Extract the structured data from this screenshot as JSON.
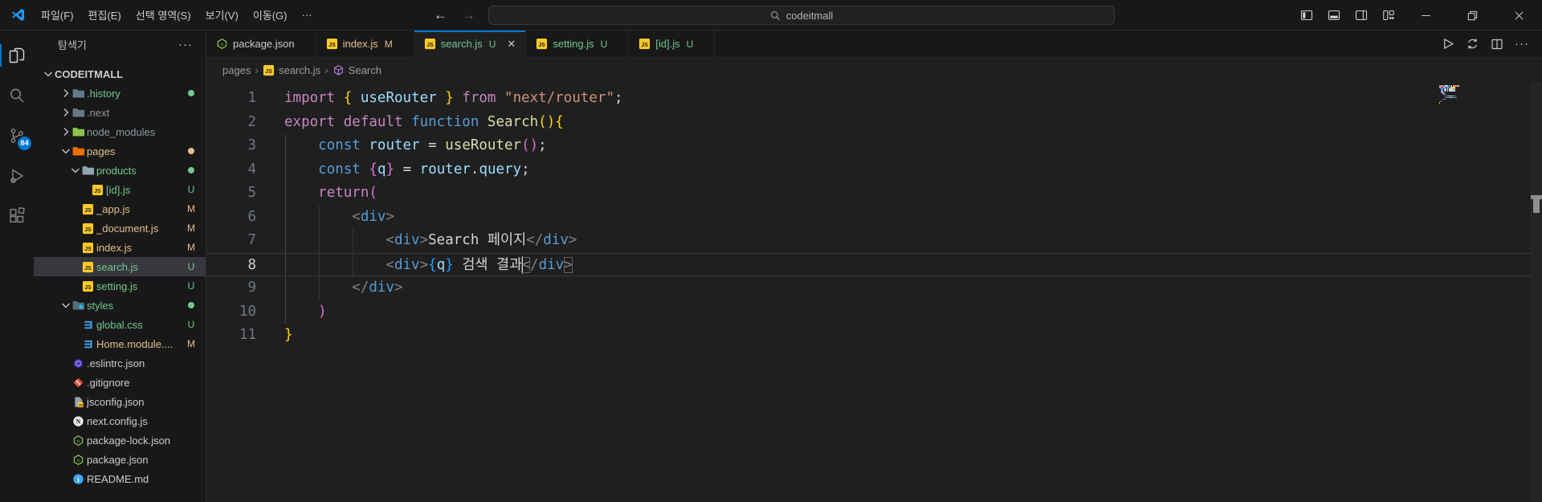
{
  "titlebar": {
    "menus": [
      "파일(F)",
      "편집(E)",
      "선택 영역(S)",
      "보기(V)",
      "이동(G)"
    ],
    "menu_more": "···",
    "search": "codeitmall",
    "window_controls": [
      "toggle-primary-sidebar",
      "toggle-panel",
      "toggle-secondary-sidebar",
      "customize-layout",
      "minimize",
      "restore",
      "close"
    ]
  },
  "activitybar": {
    "items": [
      {
        "name": "explorer",
        "active": true
      },
      {
        "name": "search",
        "active": false
      },
      {
        "name": "source-control",
        "active": false,
        "badge": "84"
      },
      {
        "name": "run-debug",
        "active": false
      },
      {
        "name": "extensions",
        "active": false
      }
    ]
  },
  "sidebar": {
    "title": "탐색기",
    "more": "···",
    "root": "CODEITMALL",
    "items": [
      {
        "label": ".history",
        "type": "folder",
        "level": 1,
        "expanded": false,
        "color": "green",
        "dot": "green",
        "icon": "folder-history"
      },
      {
        "label": ".next",
        "type": "folder",
        "level": 1,
        "expanded": false,
        "color": "gray",
        "dot": "",
        "icon": "folder-next"
      },
      {
        "label": "node_modules",
        "type": "folder",
        "level": 1,
        "expanded": false,
        "color": "gray",
        "dot": "",
        "icon": "folder-node"
      },
      {
        "label": "pages",
        "type": "folder",
        "level": 1,
        "expanded": true,
        "color": "tan",
        "dot": "tan",
        "icon": "folder-pages"
      },
      {
        "label": "products",
        "type": "folder",
        "level": 2,
        "expanded": true,
        "color": "green",
        "dot": "green",
        "icon": "folder-products"
      },
      {
        "label": "[id].js",
        "type": "file",
        "level": 3,
        "color": "green",
        "badge": "U",
        "icon": "js"
      },
      {
        "label": "_app.js",
        "type": "file",
        "level": 2,
        "color": "tan",
        "badge": "M",
        "icon": "js"
      },
      {
        "label": "_document.js",
        "type": "file",
        "level": 2,
        "color": "tan",
        "badge": "M",
        "icon": "js"
      },
      {
        "label": "index.js",
        "type": "file",
        "level": 2,
        "color": "tan",
        "badge": "M",
        "icon": "js"
      },
      {
        "label": "search.js",
        "type": "file",
        "level": 2,
        "color": "green",
        "badge": "U",
        "icon": "js",
        "selected": true
      },
      {
        "label": "setting.js",
        "type": "file",
        "level": 2,
        "color": "green",
        "badge": "U",
        "icon": "js"
      },
      {
        "label": "styles",
        "type": "folder",
        "level": 1,
        "expanded": true,
        "color": "green",
        "dot": "green",
        "icon": "folder-styles"
      },
      {
        "label": "global.css",
        "type": "file",
        "level": 2,
        "color": "green",
        "badge": "U",
        "icon": "css"
      },
      {
        "label": "Home.module....",
        "type": "file",
        "level": 2,
        "color": "tan",
        "badge": "M",
        "icon": "css"
      },
      {
        "label": ".eslintrc.json",
        "type": "file",
        "level": 1,
        "color": "default",
        "icon": "eslint"
      },
      {
        "label": ".gitignore",
        "type": "file",
        "level": 1,
        "color": "default",
        "icon": "git"
      },
      {
        "label": "jsconfig.json",
        "type": "file",
        "level": 1,
        "color": "default",
        "icon": "jsconfig"
      },
      {
        "label": "next.config.js",
        "type": "file",
        "level": 1,
        "color": "default",
        "icon": "next"
      },
      {
        "label": "package-lock.json",
        "type": "file",
        "level": 1,
        "color": "default",
        "icon": "npm"
      },
      {
        "label": "package.json",
        "type": "file",
        "level": 1,
        "color": "default",
        "icon": "npm"
      },
      {
        "label": "README.md",
        "type": "file",
        "level": 1,
        "color": "default",
        "icon": "readme"
      }
    ]
  },
  "tabs": [
    {
      "label": "package.json",
      "icon": "npm",
      "badge": "",
      "color": "default",
      "active": false
    },
    {
      "label": "index.js",
      "icon": "js",
      "badge": "M",
      "color": "tan",
      "active": false
    },
    {
      "label": "search.js",
      "icon": "js",
      "badge": "U",
      "color": "green",
      "active": true,
      "close": "✕"
    },
    {
      "label": "setting.js",
      "icon": "js",
      "badge": "U",
      "color": "green",
      "active": false
    },
    {
      "label": "[id].js",
      "icon": "js",
      "badge": "U",
      "color": "green",
      "active": false
    }
  ],
  "editor_actions": [
    "run",
    "compare-changes",
    "split-editor",
    "more-actions"
  ],
  "breadcrumb": [
    {
      "label": "pages",
      "icon": ""
    },
    {
      "label": "search.js",
      "icon": "js"
    },
    {
      "label": "Search",
      "icon": "symbol-method"
    }
  ],
  "code": {
    "active_line": 8,
    "lines": [
      {
        "num": "1",
        "tokens": [
          [
            "import ",
            "kw"
          ],
          [
            "{",
            "b1"
          ],
          [
            " ",
            "ws"
          ],
          [
            "useRouter",
            "var"
          ],
          [
            " ",
            "ws"
          ],
          [
            "}",
            "b1"
          ],
          [
            " ",
            "ws"
          ],
          [
            "from",
            "kw"
          ],
          [
            " ",
            "ws"
          ],
          [
            "\"next/router\"",
            "str"
          ],
          [
            ";",
            "pun"
          ]
        ]
      },
      {
        "num": "2",
        "tokens": [
          [
            "export",
            "kw"
          ],
          [
            " ",
            "ws"
          ],
          [
            "default",
            "kw"
          ],
          [
            " ",
            "ws"
          ],
          [
            "function",
            "kw2"
          ],
          [
            " ",
            "ws"
          ],
          [
            "Search",
            "fn"
          ],
          [
            "(",
            "b1"
          ],
          [
            ")",
            "b1"
          ],
          [
            "{",
            "b1"
          ]
        ]
      },
      {
        "num": "3",
        "tokens": [
          [
            "    ",
            "ws"
          ],
          [
            "const",
            "kw2"
          ],
          [
            " ",
            "ws"
          ],
          [
            "router",
            "var"
          ],
          [
            " ",
            "ws"
          ],
          [
            "=",
            "pun"
          ],
          [
            " ",
            "ws"
          ],
          [
            "useRouter",
            "fn"
          ],
          [
            "(",
            "b2"
          ],
          [
            ")",
            "b2"
          ],
          [
            ";",
            "pun"
          ]
        ]
      },
      {
        "num": "4",
        "tokens": [
          [
            "    ",
            "ws"
          ],
          [
            "const",
            "kw2"
          ],
          [
            " ",
            "ws"
          ],
          [
            "{",
            "b2"
          ],
          [
            "q",
            "var"
          ],
          [
            "}",
            "b2"
          ],
          [
            " ",
            "ws"
          ],
          [
            "=",
            "pun"
          ],
          [
            " ",
            "ws"
          ],
          [
            "router",
            "var"
          ],
          [
            ".",
            "pun"
          ],
          [
            "query",
            "var"
          ],
          [
            ";",
            "pun"
          ]
        ]
      },
      {
        "num": "5",
        "tokens": [
          [
            "    ",
            "ws"
          ],
          [
            "return",
            "kw"
          ],
          [
            "(",
            "b2"
          ]
        ]
      },
      {
        "num": "6",
        "tokens": [
          [
            "        ",
            "ws"
          ],
          [
            "<",
            "ang"
          ],
          [
            "div",
            "tag"
          ],
          [
            ">",
            "ang"
          ]
        ]
      },
      {
        "num": "7",
        "tokens": [
          [
            "            ",
            "ws"
          ],
          [
            "<",
            "ang"
          ],
          [
            "div",
            "tag"
          ],
          [
            ">",
            "ang"
          ],
          [
            "Search 페이지",
            "txt"
          ],
          [
            "</",
            "ang"
          ],
          [
            "div",
            "tag"
          ],
          [
            ">",
            "ang"
          ]
        ]
      },
      {
        "num": "8",
        "tokens": [
          [
            "            ",
            "ws"
          ],
          [
            "<",
            "ang"
          ],
          [
            "div",
            "tag"
          ],
          [
            ">",
            "ang"
          ],
          [
            "{",
            "b3"
          ],
          [
            "q",
            "var"
          ],
          [
            "}",
            "b3"
          ],
          [
            " 검색 결과",
            "txt"
          ],
          [
            "",
            "cursor"
          ],
          [
            "<",
            "angm"
          ],
          [
            "/",
            "ang"
          ],
          [
            "div",
            "tag"
          ],
          [
            ">",
            "angm"
          ]
        ]
      },
      {
        "num": "9",
        "tokens": [
          [
            "        ",
            "ws"
          ],
          [
            "</",
            "ang"
          ],
          [
            "div",
            "tag"
          ],
          [
            ">",
            "ang"
          ]
        ]
      },
      {
        "num": "10",
        "tokens": [
          [
            "    ",
            "ws"
          ],
          [
            ")",
            "b2"
          ]
        ]
      },
      {
        "num": "11",
        "tokens": [
          [
            "}",
            "b1"
          ]
        ]
      }
    ]
  },
  "colors": {
    "accent": "#0078d4",
    "git_untracked": "#73c991",
    "git_modified": "#e2c08d",
    "git_ignored": "#8f989e",
    "text_default": "#cccccc",
    "tokens": {
      "kw": "#c586c0",
      "kw2": "#569cd6",
      "fn": "#dcdcaa",
      "var": "#9cdcfe",
      "str": "#ce9178",
      "pun": "#d4d4d4",
      "ang": "#808080",
      "angm": "#808080",
      "tag": "#569cd6",
      "txt": "#d4d4d4",
      "b1": "#ffd700",
      "b2": "#da70d6",
      "b3": "#179fff"
    }
  }
}
